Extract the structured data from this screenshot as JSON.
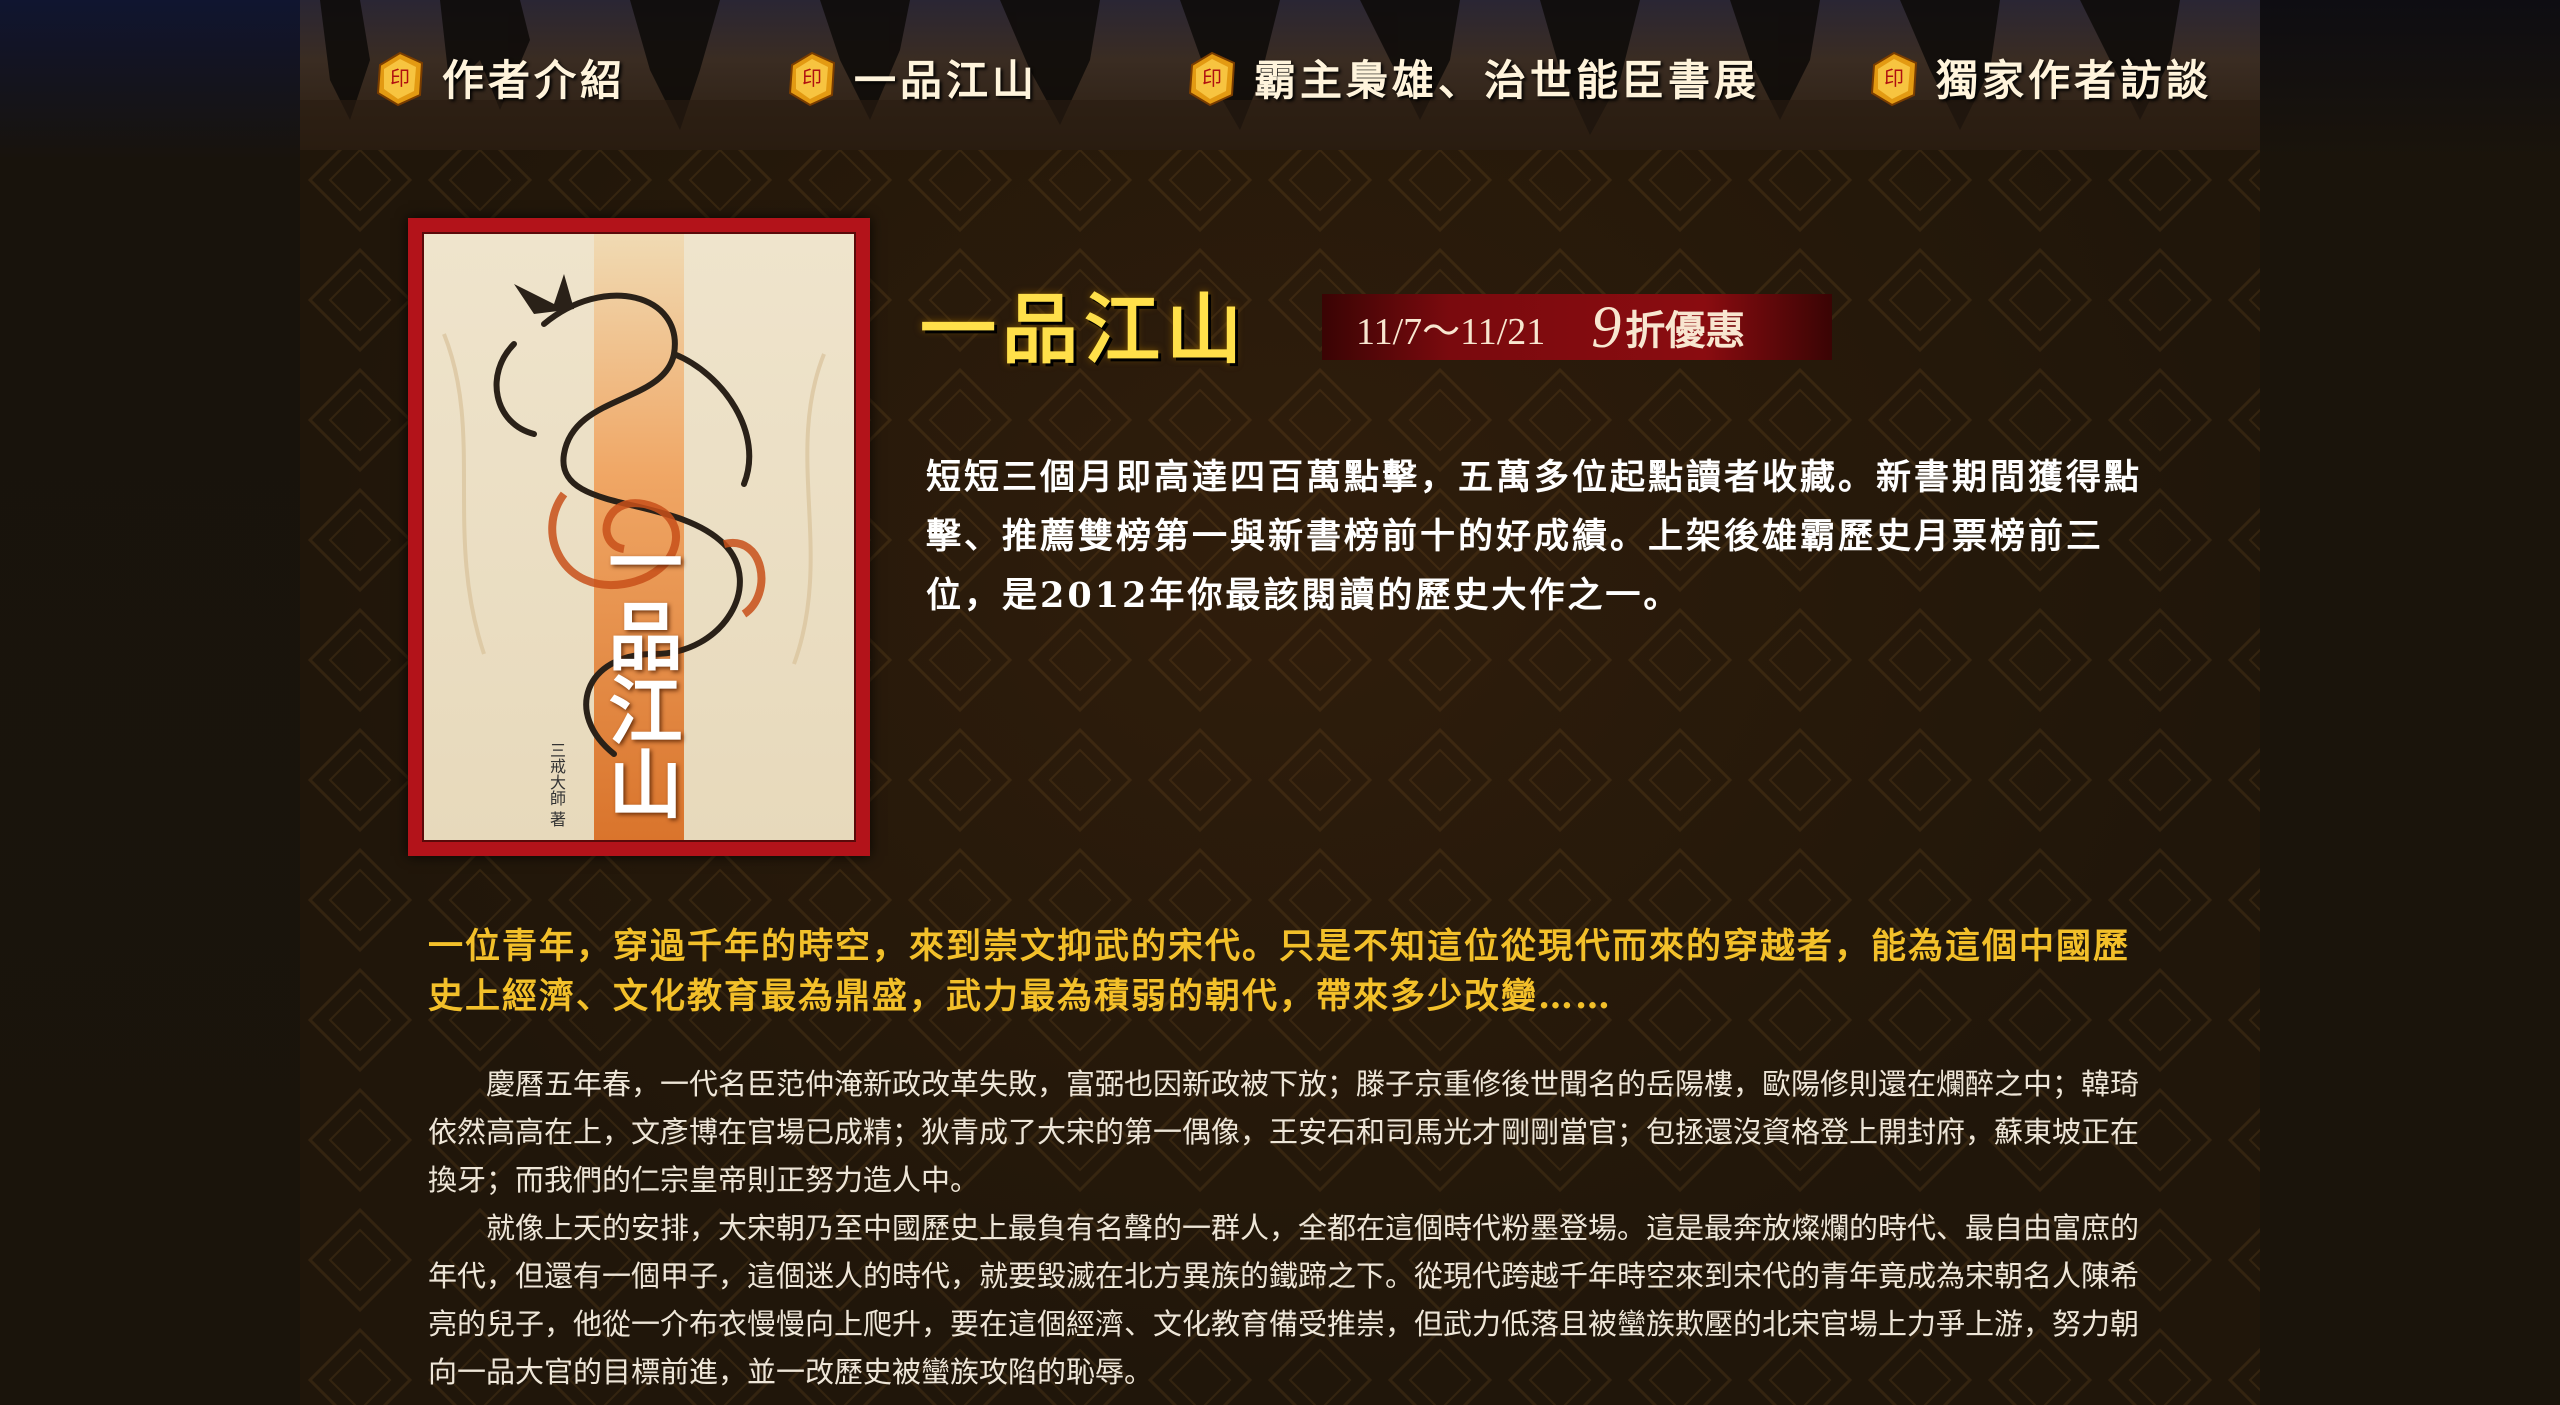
{
  "nav": {
    "items": [
      {
        "label": "作者介紹",
        "icon": "seal-icon"
      },
      {
        "label": "一品江山",
        "icon": "seal-icon"
      },
      {
        "label": "霸主梟雄、治世能臣書展",
        "icon": "seal-icon"
      },
      {
        "label": "獨家作者訪談",
        "icon": "seal-icon"
      }
    ]
  },
  "book": {
    "cover_title": "一品江山",
    "cover_author": "三戒大師 著",
    "title": "一品江山",
    "promo_date": "11/7～11/21",
    "promo_discount": "9",
    "promo_discount_suffix": "折優惠",
    "intro": "短短三個月即高達四百萬點擊，五萬多位起點讀者收藏。新書期間獲得點擊、推薦雙榜第一與新書榜前十的好成績。上架後雄霸歷史月票榜前三位，是2012年你最該閱讀的歷史大作之一。",
    "teaser": "一位青年，穿過千年的時空，來到崇文抑武的宋代。只是不知這位從現代而來的穿越者，能為這個中國歷史上經濟、文化教育最為鼎盛，武力最為積弱的朝代，帶來多少改變……",
    "paragraphs": [
      "慶曆五年春，一代名臣范仲淹新政改革失敗，富弼也因新政被下放；滕子京重修後世聞名的岳陽樓，歐陽修則還在爛醉之中；韓琦依然高高在上，文彥博在官場已成精；狄青成了大宋的第一偶像，王安石和司馬光才剛剛當官；包拯還沒資格登上開封府，蘇東坡正在換牙；而我們的仁宗皇帝則正努力造人中。",
      "就像上天的安排，大宋朝乃至中國歷史上最負有名聲的一群人，全都在這個時代粉墨登場。這是最奔放燦爛的時代、最自由富庶的年代，但還有一個甲子，這個迷人的時代，就要毀滅在北方異族的鐵蹄之下。從現代跨越千年時空來到宋代的青年竟成為宋朝名人陳希亮的兒子，他從一介布衣慢慢向上爬升，要在這個經濟、文化教育備受推崇，但武力低落且被蠻族欺壓的北宋官場上力爭上游，努力朝向一品大官的目標前進，並一改歷史被蠻族攻陷的恥辱。"
    ]
  },
  "colors": {
    "title": "#ffe04a",
    "teaser": "#f3c02a",
    "frame": "#b3131a",
    "promo_bg": "#8a0c10"
  }
}
